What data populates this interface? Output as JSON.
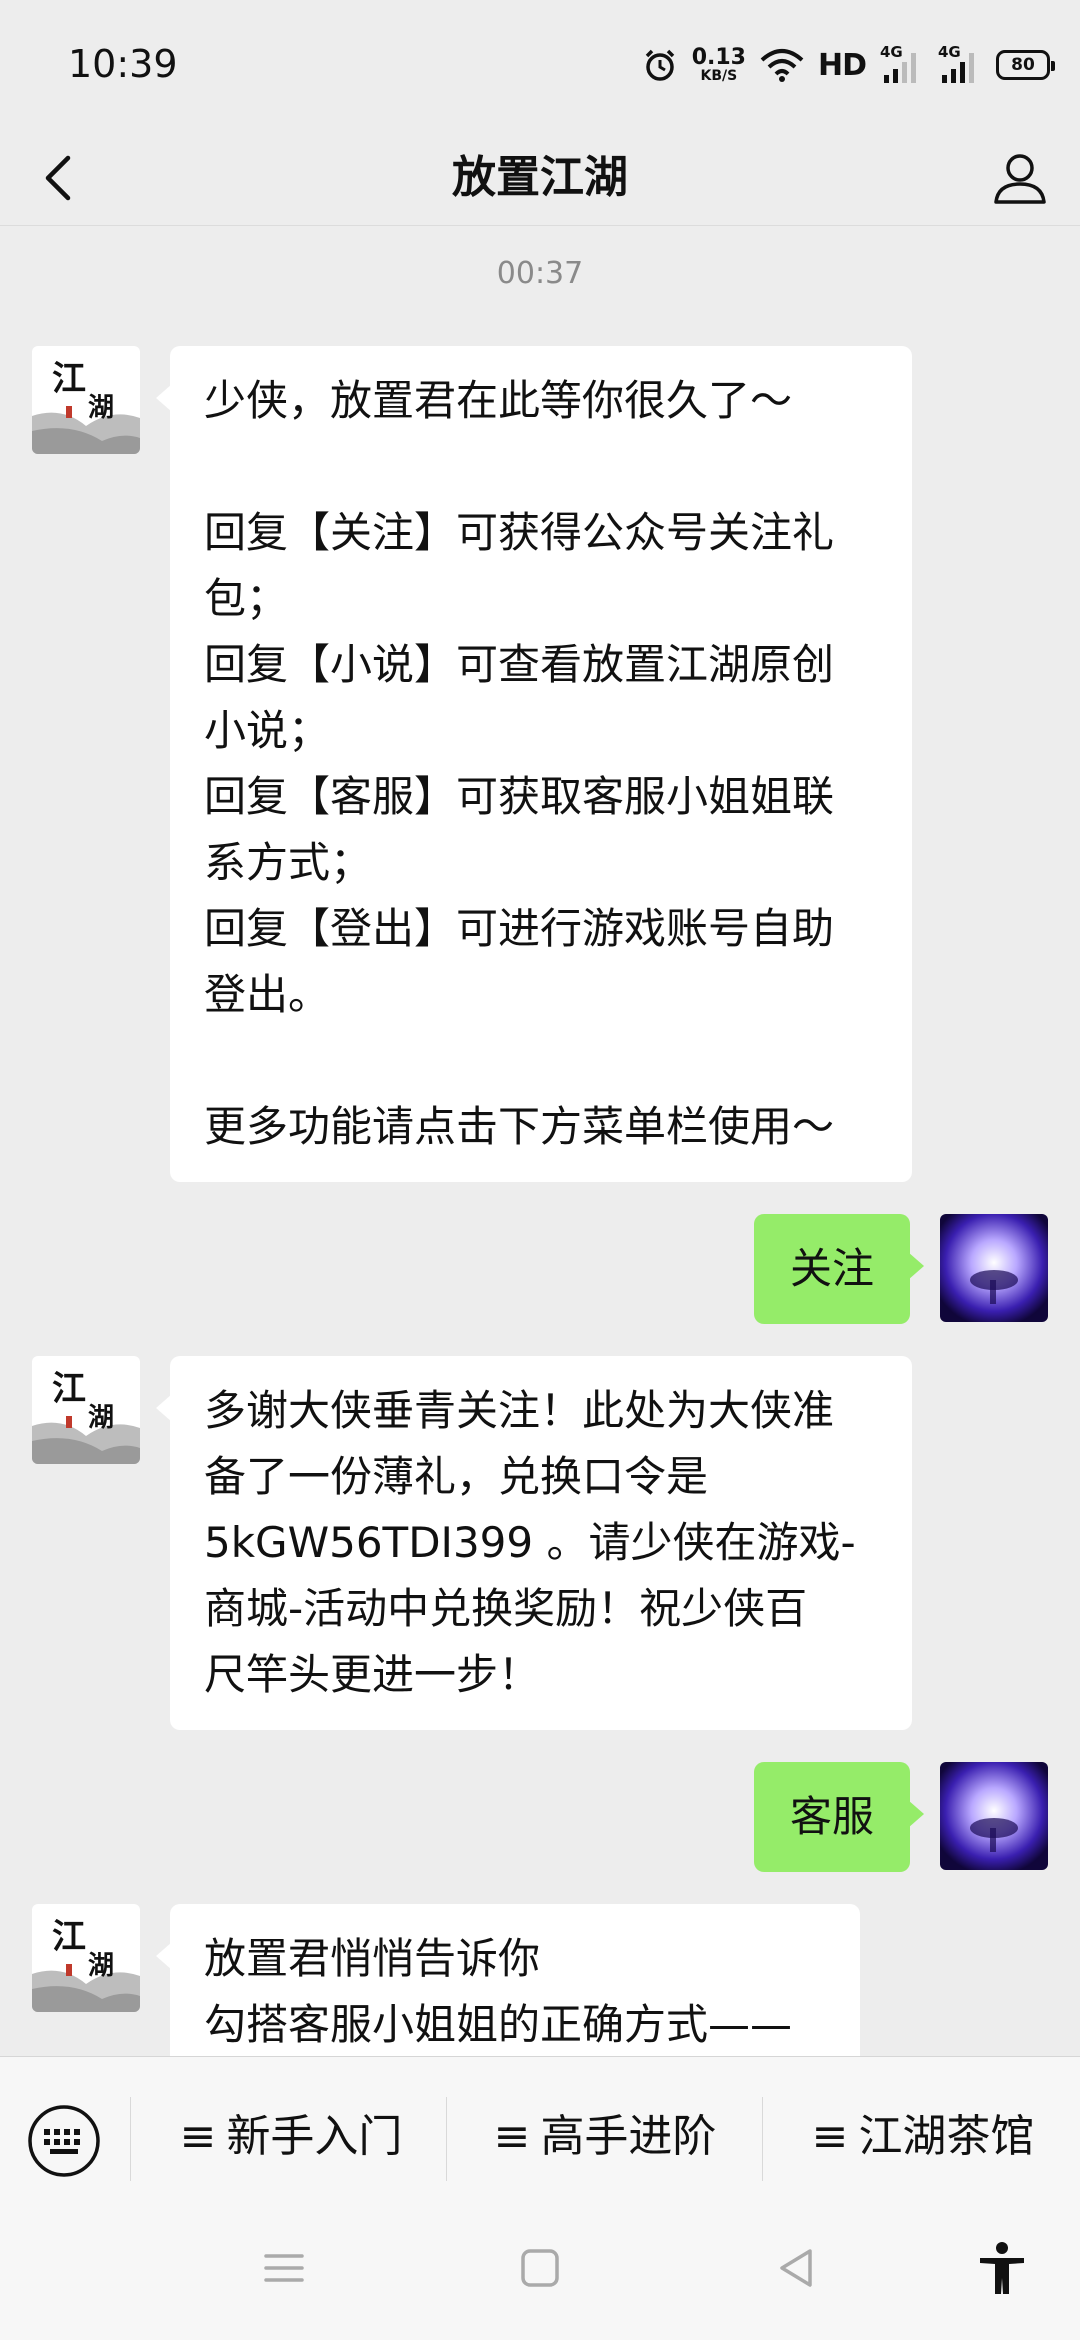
{
  "status_bar": {
    "time": "10:39",
    "net_speed_value": "0.13",
    "net_speed_unit": "KB/S",
    "hd": "HD",
    "sig1": "4G",
    "sig2": "4G",
    "battery": "80"
  },
  "nav": {
    "title": "放置江湖"
  },
  "chat": {
    "timestamp": "00:37",
    "avatar_text_top": "江",
    "avatar_text_bottom": "湖",
    "messages": [
      {
        "side": "left",
        "text": "少侠，放置君在此等你很久了～\n\n回复【关注】可获得公众号关注礼\n包；\n回复【小说】可查看放置江湖原创\n小说；\n回复【客服】可获取客服小姐姐联\n系方式；\n回复【登出】可进行游戏账号自助\n登出。\n\n更多功能请点击下方菜单栏使用～"
      },
      {
        "side": "right",
        "text": "关注"
      },
      {
        "side": "left",
        "text": "多谢大侠垂青关注！此处为大侠准\n备了一份薄礼，兑换口令是\n5kGW56TDI399 。请少侠在游戏-\n商城-活动中兑换奖励！祝少侠百\n尺竿头更进一步！"
      },
      {
        "side": "right",
        "text": "客服"
      },
      {
        "side": "left",
        "text": "放置君悄悄告诉你\n勾搭客服小姐姐的正确方式——"
      }
    ]
  },
  "menu": {
    "prefix": "≡",
    "items": [
      "新手入门",
      "高手进阶",
      "江湖茶馆"
    ]
  },
  "colors": {
    "background": "#ededed",
    "bubble_self": "#95ec69",
    "bubble_other": "#ffffff"
  }
}
